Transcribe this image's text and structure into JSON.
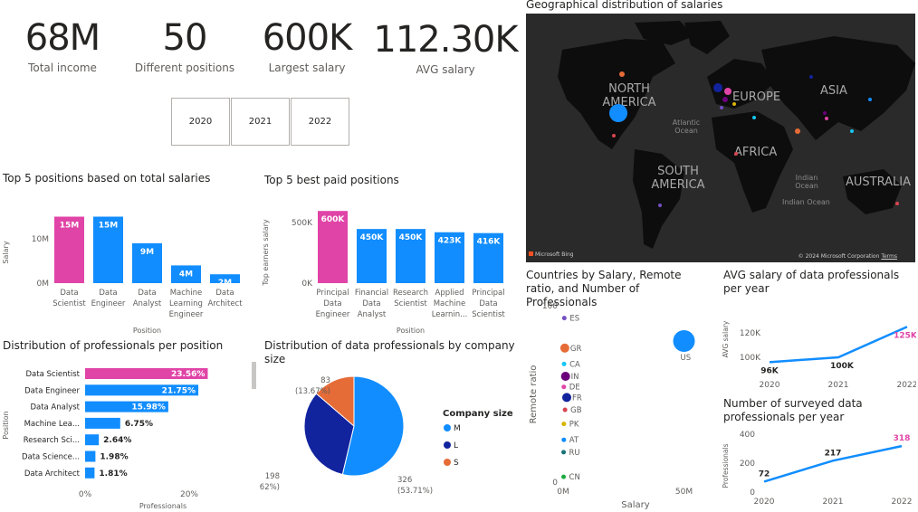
{
  "kpis": [
    {
      "value": "68M",
      "label": "Total income"
    },
    {
      "value": "50",
      "label": "Different positions"
    },
    {
      "value": "600K",
      "label": "Largest salary"
    },
    {
      "value": "112.30K",
      "label": "AVG salary"
    }
  ],
  "year_slicer": [
    "2020",
    "2021",
    "2022"
  ],
  "colors": {
    "blue": "#118dff",
    "pink": "#e044a7",
    "navy": "#12239e",
    "orange": "#e66c37",
    "map_bg": "#2a2a2a"
  },
  "map": {
    "title": "Geographical distribution of salaries",
    "labels": {
      "north_america": "NORTH AMERICA",
      "europe": "EUROPE",
      "asia": "ASIA",
      "africa": "AFRICA",
      "south_america": "SOUTH AMERICA",
      "australia": "AUSTRALIA",
      "atlantic": "Atlantic Ocean",
      "indian": "Indian Ocean",
      "indian2": "Indian Ocean"
    },
    "bing": "Microsoft Bing",
    "copyright": "© 2024 Microsoft Corporation",
    "terms": "Terms"
  },
  "top_total": {
    "title": "Top 5 positions based on total salaries",
    "ylabel": "Salary",
    "xlabel": "Position",
    "ticks": [
      "10M",
      "0M"
    ],
    "categories": [
      "Data Scientist",
      "Data Engineer",
      "Data Analyst",
      "Machine Learning Engineer",
      "Data Architect"
    ],
    "cat_lines": [
      [
        "Data",
        "Scientist"
      ],
      [
        "Data",
        "Engineer"
      ],
      [
        "Data",
        "Analyst"
      ],
      [
        "Machine",
        "Learning",
        "Engineer"
      ],
      [
        "Data",
        "Architect"
      ]
    ],
    "values": [
      15,
      15,
      9,
      4,
      2
    ],
    "labels": [
      "15M",
      "15M",
      "9M",
      "4M",
      "2M"
    ]
  },
  "top_paid": {
    "title": "Top 5 best paid positions",
    "ylabel": "Top earners salary",
    "xlabel": "Position",
    "ticks": [
      "500K",
      "0K"
    ],
    "categories": [
      "Principal Data Engineer",
      "Financial Data Analyst",
      "Research Scientist",
      "Applied Machine Learnin...",
      "Principal Data Scientist"
    ],
    "cat_lines": [
      [
        "Principal",
        "Data",
        "Engineer"
      ],
      [
        "Financial",
        "Data",
        "Analyst"
      ],
      [
        "Research",
        "Scientist"
      ],
      [
        "Applied",
        "Machine",
        "Learnin..."
      ],
      [
        "Principal",
        "Data",
        "Scientist"
      ]
    ],
    "values": [
      600,
      450,
      450,
      423,
      416
    ],
    "labels": [
      "600K",
      "450K",
      "450K",
      "423K",
      "416K"
    ]
  },
  "dist_pos": {
    "title": "Distribution of professionals per position",
    "ylabel": "Position",
    "xlabel": "Professionals",
    "ticks": [
      "0%",
      "20%"
    ],
    "categories": [
      "Data Scientist",
      "Data Engineer",
      "Data Analyst",
      "Machine Lea...",
      "Research Sci...",
      "Data Science...",
      "Data Architect"
    ],
    "values": [
      23.56,
      21.75,
      15.98,
      6.75,
      2.64,
      1.98,
      1.81
    ],
    "labels": [
      "23.56%",
      "21.75%",
      "15.98%",
      "6.75%",
      "2.64%",
      "1.98%",
      "1.81%"
    ]
  },
  "company": {
    "title": "Distribution of data professionals by company size",
    "legend_title": "Company size",
    "slices": [
      {
        "name": "M",
        "value": 326,
        "pct": "(53.71%)"
      },
      {
        "name": "L",
        "value": 198,
        "pct": "(32.62%)"
      },
      {
        "name": "S",
        "value": 83,
        "pct": "(13.67%)"
      }
    ]
  },
  "scatter": {
    "title": "Countries by Salary, Remote ratio, and Number of Professionals",
    "xlabel": "Salary",
    "ylabel": "Remote ratio",
    "yticks": [
      "100",
      "50",
      "0"
    ],
    "xticks": [
      "0M",
      "50M"
    ],
    "points": [
      {
        "label": "US",
        "x": 50,
        "y": 80
      },
      {
        "label": "ES",
        "x": 0.5,
        "y": 93
      },
      {
        "label": "GR",
        "x": 0.7,
        "y": 76
      },
      {
        "label": "CA",
        "x": 0.4,
        "y": 67
      },
      {
        "label": "IN",
        "x": 1,
        "y": 60
      },
      {
        "label": "DE",
        "x": 0.3,
        "y": 54
      },
      {
        "label": "FR",
        "x": 1.5,
        "y": 48
      },
      {
        "label": "GB",
        "x": 0.8,
        "y": 41
      },
      {
        "label": "PK",
        "x": 0.3,
        "y": 33
      },
      {
        "label": "AT",
        "x": 0.3,
        "y": 24
      },
      {
        "label": "RU",
        "x": 0.2,
        "y": 17
      },
      {
        "label": "CN",
        "x": 0.2,
        "y": 3
      }
    ]
  },
  "avg_salary": {
    "title": "AVG salary of data professionals per year",
    "ylabel": "AVG salary",
    "yticks": [
      "120K",
      "100K"
    ],
    "x": [
      "2020",
      "2021",
      "2022"
    ],
    "values": [
      96,
      100,
      125
    ],
    "labels": [
      "96K",
      "100K",
      "125K"
    ]
  },
  "surveyed": {
    "title": "Number of surveyed data professionals per year",
    "ylabel": "Professionals",
    "yticks": [
      "400",
      "200",
      "0"
    ],
    "x": [
      "2020",
      "2021",
      "2022"
    ],
    "values": [
      72,
      217,
      318
    ],
    "labels": [
      "72",
      "217",
      "318"
    ]
  }
}
